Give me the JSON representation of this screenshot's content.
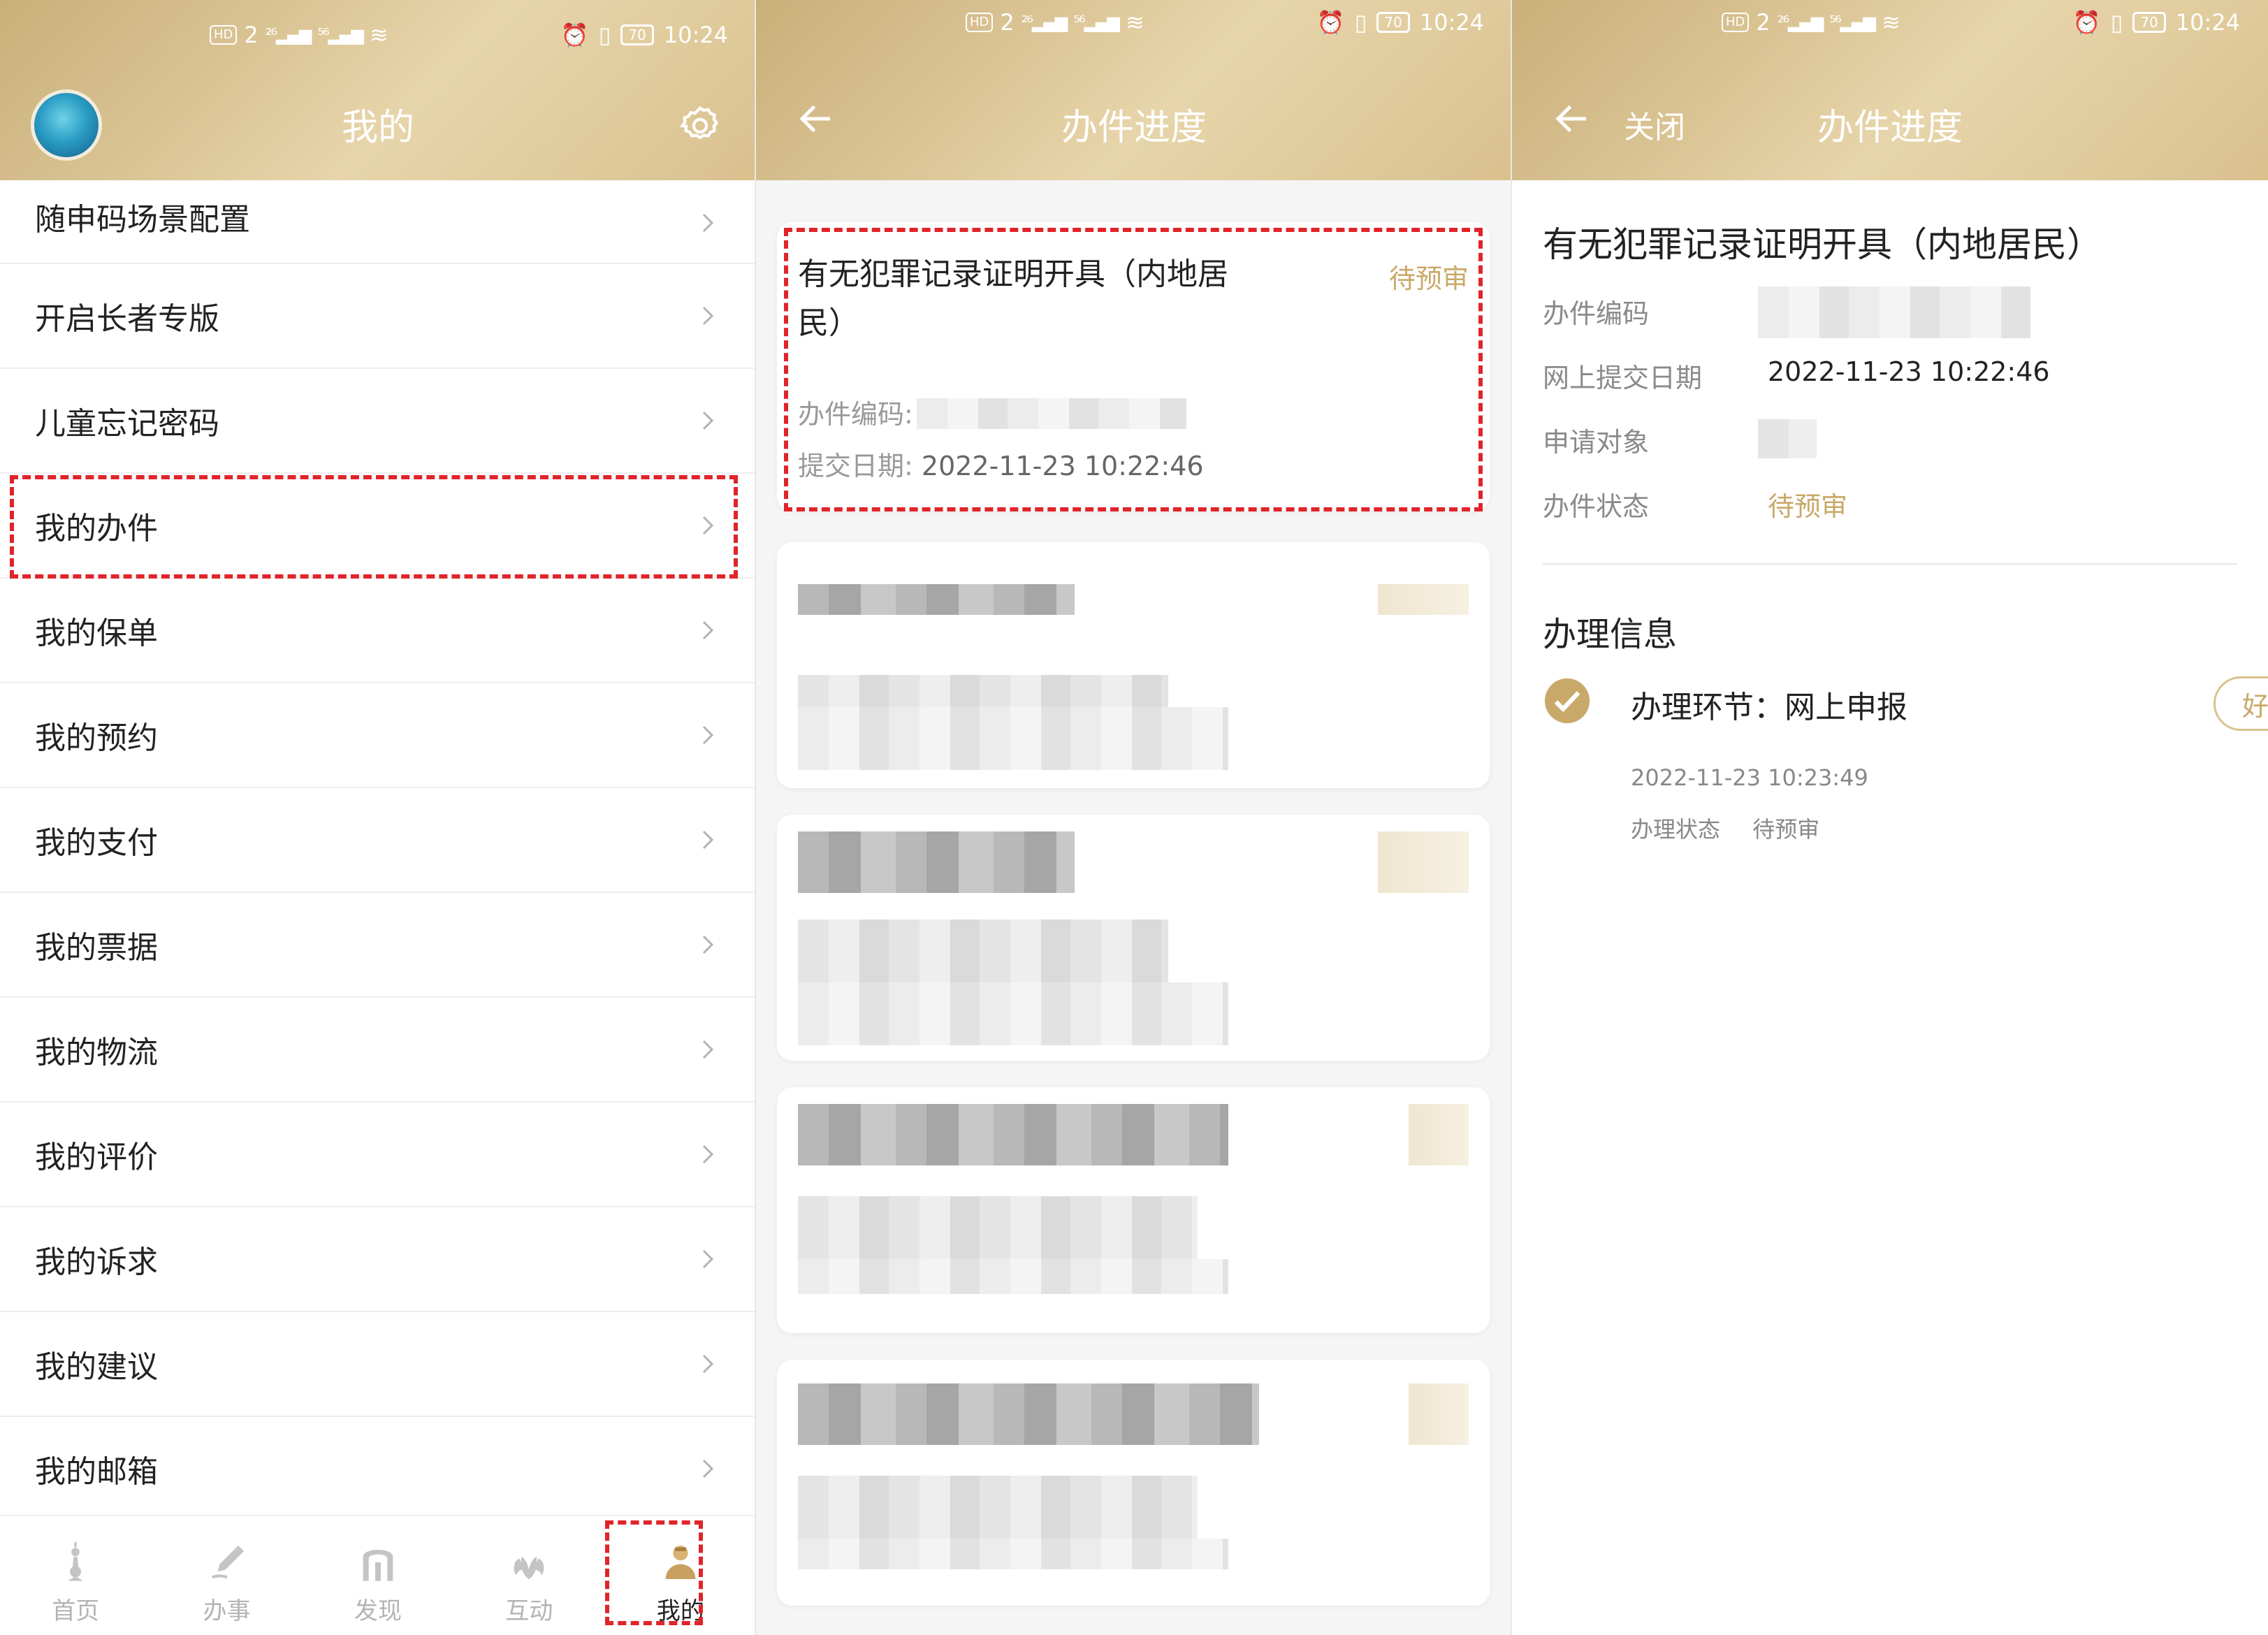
{
  "status_bar": {
    "hd": "HD",
    "sim": "2",
    "net1": "²⁶",
    "net2": "⁵⁶",
    "battery": "70",
    "time": "10:24"
  },
  "panel1": {
    "title": "我的",
    "menu": [
      {
        "label": "随申码场景配置"
      },
      {
        "label": "开启长者专版"
      },
      {
        "label": "儿童忘记密码"
      },
      {
        "label": "我的办件"
      },
      {
        "label": "我的保单"
      },
      {
        "label": "我的预约"
      },
      {
        "label": "我的支付"
      },
      {
        "label": "我的票据"
      },
      {
        "label": "我的物流"
      },
      {
        "label": "我的评价"
      },
      {
        "label": "我的诉求"
      },
      {
        "label": "我的建议"
      },
      {
        "label": "我的邮箱"
      }
    ],
    "tabs": [
      {
        "label": "首页",
        "icon": "tower-icon"
      },
      {
        "label": "办事",
        "icon": "pen-icon"
      },
      {
        "label": "发现",
        "icon": "arch-icon"
      },
      {
        "label": "互动",
        "icon": "magnolia-icon"
      },
      {
        "label": "我的",
        "icon": "user-icon",
        "active": true
      }
    ]
  },
  "panel2": {
    "title": "办件进度",
    "card": {
      "title": "有无犯罪记录证明开具（内地居民）",
      "status": "待预审",
      "code_label": "办件编码:",
      "date_label": "提交日期:",
      "date_value": "2022-11-23 10:22:46"
    }
  },
  "panel3": {
    "close": "关闭",
    "title": "办件进度",
    "item_title": "有无犯罪记录证明开具（内地居民）",
    "fields": {
      "code_label": "办件编码",
      "date_label": "网上提交日期",
      "date_value": "2022-11-23 10:22:46",
      "target_label": "申请对象",
      "state_label": "办件状态",
      "state_value": "待预审"
    },
    "section_title": "办理信息",
    "step_label": "办理环节：网上申报",
    "rate_button": "好差评",
    "step_time": "2022-11-23 10:23:49",
    "step_state_label": "办理状态",
    "step_state_value": "待预审"
  },
  "colors": {
    "header_gold": "#d9c18e",
    "status_gold": "#c9a96a",
    "highlight_red": "#e0242a"
  }
}
